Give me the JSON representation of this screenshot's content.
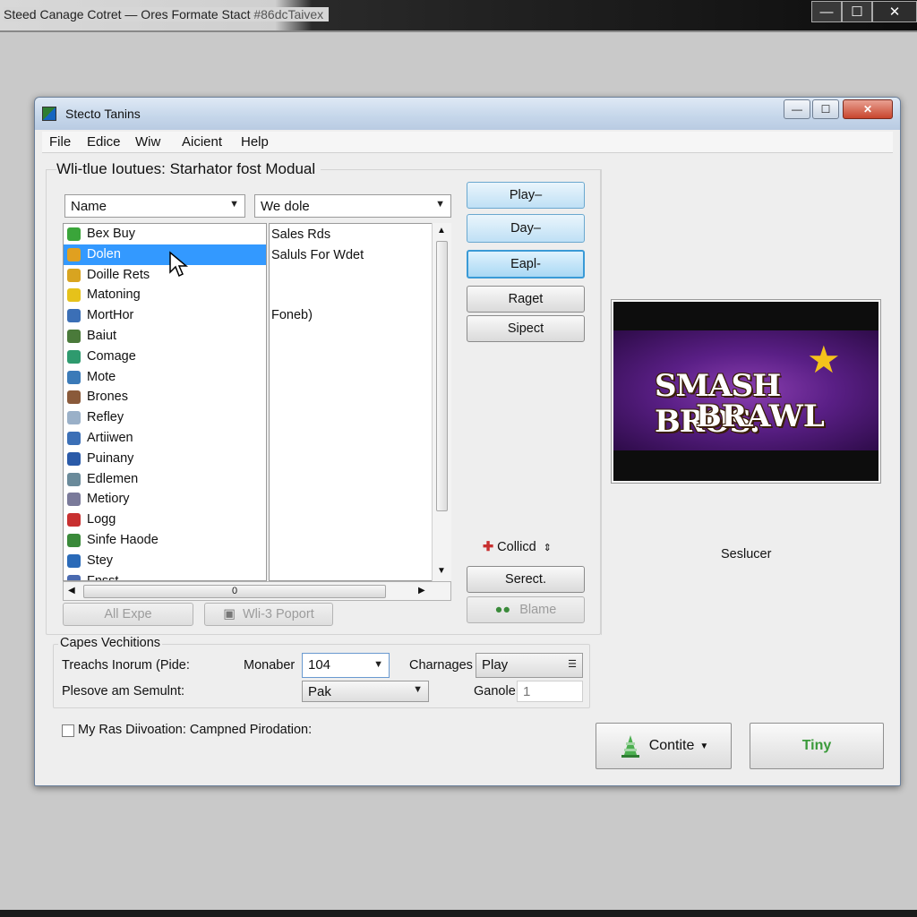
{
  "outer_window": {
    "title": "Steed Canage Cotret — Ores Formate Stact",
    "title_tail": " #86dcTaivex",
    "minimize": "—",
    "maximize": "☐",
    "close": "✕"
  },
  "dialog": {
    "title": "Stecto Tanins",
    "minimize": "—",
    "maximize": "☐",
    "close": "✕"
  },
  "menu": [
    "File",
    "Edice",
    "Wiw",
    "Aicient",
    "Help"
  ],
  "section_title": "Wli-tlue Ioutues: Starhator fost Modual",
  "combo_name": "Name",
  "combo_wedole": "We dole",
  "left_list": [
    {
      "label": "Bex Buy",
      "icon": "green-check-icon",
      "color": "#3aa53a"
    },
    {
      "label": "Dolen",
      "icon": "folder-icon",
      "color": "#e0a020",
      "selected": true
    },
    {
      "label": "Doille Rets",
      "icon": "gear-icon",
      "color": "#d8a420"
    },
    {
      "label": "Matoning",
      "icon": "smiley-icon",
      "color": "#e6c21a"
    },
    {
      "label": "MortHor",
      "icon": "users-icon",
      "color": "#3b6fb6"
    },
    {
      "label": "Baiut",
      "icon": "game-icon",
      "color": "#4a7a3a"
    },
    {
      "label": "Comage",
      "icon": "image-icon",
      "color": "#2e9a6e"
    },
    {
      "label": "Mote",
      "icon": "monitor-icon",
      "color": "#3a7ab8"
    },
    {
      "label": "Brones",
      "icon": "person-icon",
      "color": "#8a5a3a"
    },
    {
      "label": "Refley",
      "icon": "heart-icon",
      "color": "#9ab0c8"
    },
    {
      "label": "Artiiwen",
      "icon": "photo-icon",
      "color": "#3b6fb6"
    },
    {
      "label": "Puinany",
      "icon": "document-icon",
      "color": "#2a5aa8"
    },
    {
      "label": "Edlemen",
      "icon": "disc-icon",
      "color": "#6a8a9a"
    },
    {
      "label": "Metiory",
      "icon": "chart-icon",
      "color": "#7a7a9a"
    },
    {
      "label": "Logg",
      "icon": "red-figure-icon",
      "color": "#c83030"
    },
    {
      "label": "Sinfe Haode",
      "icon": "tools-icon",
      "color": "#3a8a3a"
    },
    {
      "label": "Stey",
      "icon": "globe-icon",
      "color": "#2a6ab8"
    },
    {
      "label": "Fnsst",
      "icon": "file-icon",
      "color": "#4a6ab0"
    }
  ],
  "right_panel": {
    "line1": "Sales Rds",
    "line2": "Saluls For Wdet",
    "line3": "Foneb)"
  },
  "hscroll_value": "0",
  "side_buttons": {
    "play": "Play–",
    "day": "Day–",
    "eapl": "Eapl-",
    "raget": "Raget",
    "sipect": "Sipect"
  },
  "collicd": "Collicd",
  "select_button": "Serect.",
  "blame_button": "Blame",
  "all_expe_button": "All Expe",
  "report_button": "Wli-3 Poport",
  "preview_caption": "Seslucer",
  "logo": {
    "line1": "SMASH BROS.",
    "line2": "BRAWL"
  },
  "group_title": "Capes Vechitions",
  "row1": {
    "label": "Treachs Inorum (Pide:",
    "monaber_label": "Monaber",
    "monaber_value": "104",
    "charnages_label": "Charnages",
    "charnages_value": "Play"
  },
  "row2": {
    "label": "Plesove am Semulnt:",
    "dropdown_value": "Pak",
    "ganole_label": "Ganole",
    "ganole_value": "1"
  },
  "checkbox_label": "My Ras Diivoation: Campned Pirodation:",
  "contite_button": "Contite",
  "tiny_button": "Tiny",
  "colors": {
    "selection": "#3399ff",
    "accent_blue": "#bfe0f5",
    "brawl_purple": "#5a1f86",
    "star_gold": "#f4c21b",
    "cone_green": "#4caf50"
  }
}
